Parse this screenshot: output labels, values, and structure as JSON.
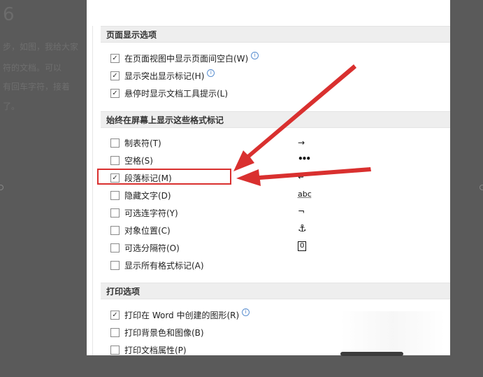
{
  "background": {
    "heading": "6",
    "lines": [
      "步，如图，我给大家",
      "符的文档。可以",
      "有回车字符，接着",
      "了。"
    ]
  },
  "sections": [
    {
      "title": "页面显示选项",
      "items": [
        {
          "label": "在页面视图中显示页面间空白(W)",
          "checked": true,
          "info": true
        },
        {
          "label": "显示突出显示标记(H)",
          "checked": true,
          "info": true
        },
        {
          "label": "悬停时显示文档工具提示(L)",
          "checked": true,
          "info": false
        }
      ]
    },
    {
      "title": "始终在屏幕上显示这些格式标记",
      "items": [
        {
          "label": "制表符(T)",
          "checked": false,
          "symbol": "→"
        },
        {
          "label": "空格(S)",
          "checked": false,
          "symbol": "•••"
        },
        {
          "label": "段落标记(M)",
          "checked": true,
          "symbol": "↵",
          "highlighted": true
        },
        {
          "label": "隐藏文字(D)",
          "checked": false,
          "symbol": "abc"
        },
        {
          "label": "可选连字符(Y)",
          "checked": false,
          "symbol": "¬"
        },
        {
          "label": "对象位置(C)",
          "checked": false,
          "symbol": "⚓"
        },
        {
          "label": "可选分隔符(O)",
          "checked": false,
          "symbol": "0"
        },
        {
          "label": "显示所有格式标记(A)",
          "checked": false
        }
      ]
    },
    {
      "title": "打印选项",
      "items": [
        {
          "label": "打印在 Word 中创建的图形(R)",
          "checked": true,
          "info": true
        },
        {
          "label": "打印背景色和图像(B)",
          "checked": false
        },
        {
          "label": "打印文档属性(P)",
          "checked": false
        }
      ]
    }
  ],
  "checkmark": "✓",
  "info_glyph": "i",
  "colors": {
    "annotation": "#d9302f",
    "info": "#2f6fc0"
  }
}
